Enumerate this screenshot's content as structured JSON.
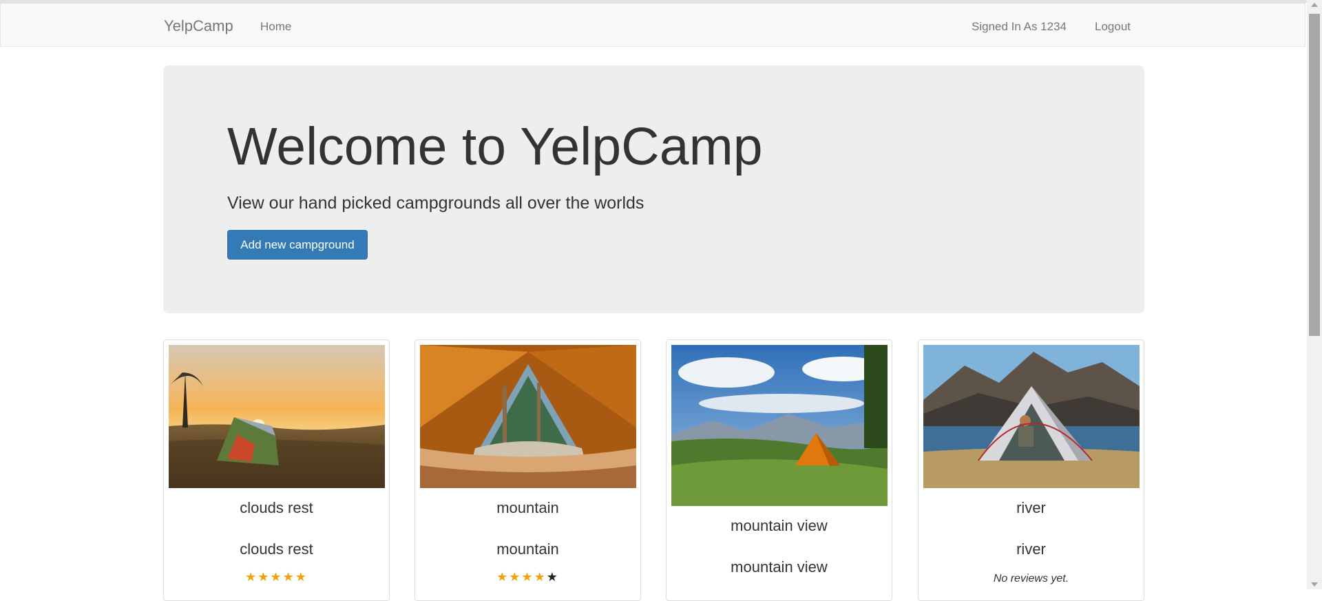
{
  "navbar": {
    "brand": "YelpCamp",
    "home": "Home",
    "signed_in": "Signed In As 1234",
    "logout": "Logout"
  },
  "jumbotron": {
    "title": "Welcome to YelpCamp",
    "subtitle": "View our hand picked campgrounds all over the worlds",
    "button": "Add new campground"
  },
  "campgrounds": [
    {
      "caption": "clouds rest",
      "name": "clouds rest",
      "rating": 5,
      "image": "sunset-tent-photo"
    },
    {
      "caption": "mountain",
      "name": "mountain",
      "rating": 4,
      "image": "tent-interior-photo"
    },
    {
      "caption": "mountain view",
      "name": "mountain view",
      "rating": null,
      "image": "mountain-valley-tent-photo"
    },
    {
      "caption": "river",
      "name": "river",
      "rating": 0,
      "reviews_text": "No reviews yet.",
      "image": "lake-tent-photo"
    }
  ],
  "colors": {
    "primary": "#337ab7",
    "star": "#f0a20a",
    "jumbotron_bg": "#eeeeee"
  }
}
